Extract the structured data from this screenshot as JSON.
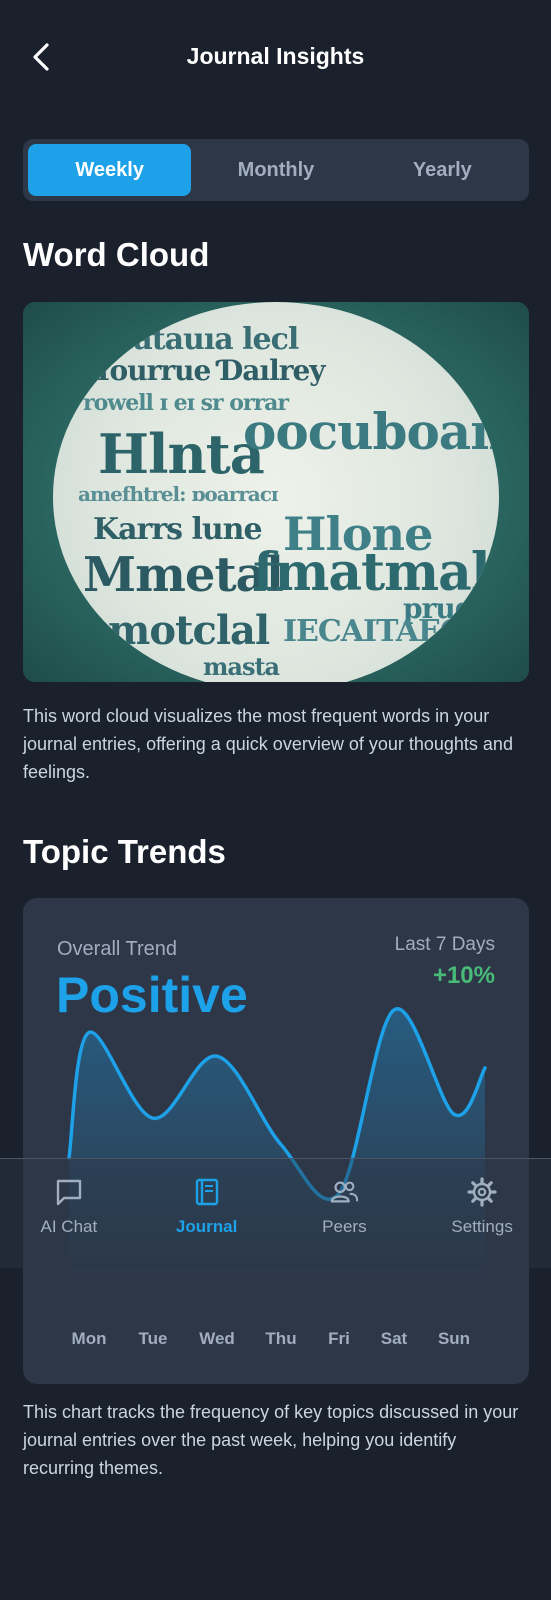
{
  "header": {
    "title": "Journal Insights",
    "back_icon": "chevron-left-icon"
  },
  "period_tabs": [
    {
      "label": "Weekly",
      "active": true
    },
    {
      "label": "Monthly",
      "active": false
    },
    {
      "label": "Yearly",
      "active": false
    }
  ],
  "word_cloud": {
    "title": "Word Cloud",
    "description": "This word cloud visualizes the most frequent words in your journal entries, offering a quick overview of your thoughts and feelings."
  },
  "topic_trends": {
    "title": "Topic Trends",
    "overall_label": "Overall Trend",
    "overall_value": "Positive",
    "period_label": "Last 7 Days",
    "change": "+10%",
    "description": "This chart tracks the frequency of key topics discussed in your journal entries over the past week, helping you identify recurring themes."
  },
  "chart_data": {
    "type": "line",
    "categories": [
      "Mon",
      "Tue",
      "Wed",
      "Thu",
      "Fri",
      "Sat",
      "Sun"
    ],
    "series": [
      {
        "values": [
          0.8,
          0.15,
          0.62,
          -0.05,
          -0.42,
          0.97,
          0.18
        ]
      }
    ],
    "title": "",
    "xlabel": "",
    "ylabel": "",
    "grid": false,
    "color": "#1da1e8"
  },
  "nav": [
    {
      "label": "AI Chat",
      "icon": "chat-bubble-icon",
      "active": false
    },
    {
      "label": "Journal",
      "icon": "book-icon",
      "active": true
    },
    {
      "label": "Peers",
      "icon": "people-icon",
      "active": false
    },
    {
      "label": "Settings",
      "icon": "gear-icon",
      "active": false
    }
  ],
  "colors": {
    "background": "#1a202c",
    "card": "#2d3748",
    "accent": "#1da1e8",
    "positive": "#48bb78",
    "muted": "#a0aec0"
  }
}
